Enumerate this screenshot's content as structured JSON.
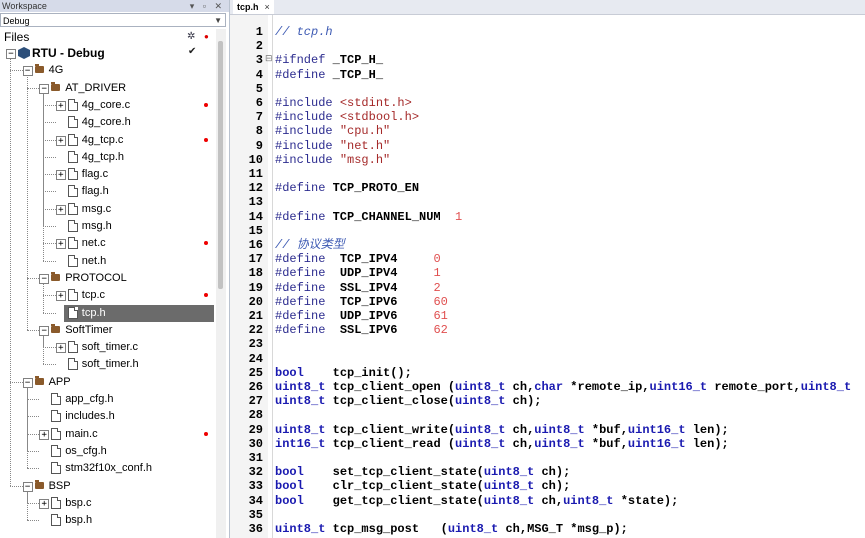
{
  "workspace": {
    "title": "Workspace",
    "config": "Debug",
    "files_label": "Files",
    "tree": [
      {
        "label": "RTU - Debug",
        "level": 0,
        "type": "project",
        "toggle": "-",
        "check": true
      },
      {
        "label": "4G",
        "level": 1,
        "type": "folder",
        "toggle": "-"
      },
      {
        "label": "AT_DRIVER",
        "level": 2,
        "type": "folder",
        "toggle": "-"
      },
      {
        "label": "4g_core.c",
        "level": 3,
        "type": "file",
        "toggle": "+",
        "dot": true
      },
      {
        "label": "4g_core.h",
        "level": 3,
        "type": "file"
      },
      {
        "label": "4g_tcp.c",
        "level": 3,
        "type": "file",
        "toggle": "+",
        "dot": true
      },
      {
        "label": "4g_tcp.h",
        "level": 3,
        "type": "file"
      },
      {
        "label": "flag.c",
        "level": 3,
        "type": "file",
        "toggle": "+"
      },
      {
        "label": "flag.h",
        "level": 3,
        "type": "file"
      },
      {
        "label": "msg.c",
        "level": 3,
        "type": "file",
        "toggle": "+"
      },
      {
        "label": "msg.h",
        "level": 3,
        "type": "file"
      },
      {
        "label": "net.c",
        "level": 3,
        "type": "file",
        "toggle": "+",
        "dot": true
      },
      {
        "label": "net.h",
        "level": 3,
        "type": "file"
      },
      {
        "label": "PROTOCOL",
        "level": 2,
        "type": "folder",
        "toggle": "-"
      },
      {
        "label": "tcp.c",
        "level": 3,
        "type": "file",
        "toggle": "+",
        "dot": true
      },
      {
        "label": "tcp.h",
        "level": 3,
        "type": "file",
        "selected": true
      },
      {
        "label": "SoftTimer",
        "level": 2,
        "type": "folder",
        "toggle": "-"
      },
      {
        "label": "soft_timer.c",
        "level": 3,
        "type": "file",
        "toggle": "+"
      },
      {
        "label": "soft_timer.h",
        "level": 3,
        "type": "file"
      },
      {
        "label": "APP",
        "level": 1,
        "type": "folder",
        "toggle": "-"
      },
      {
        "label": "app_cfg.h",
        "level": 2,
        "type": "file"
      },
      {
        "label": "includes.h",
        "level": 2,
        "type": "file"
      },
      {
        "label": "main.c",
        "level": 2,
        "type": "file",
        "toggle": "+",
        "dot": true
      },
      {
        "label": "os_cfg.h",
        "level": 2,
        "type": "file"
      },
      {
        "label": "stm32f10x_conf.h",
        "level": 2,
        "type": "file"
      },
      {
        "label": "BSP",
        "level": 1,
        "type": "folder",
        "toggle": "-"
      },
      {
        "label": "bsp.c",
        "level": 2,
        "type": "file",
        "toggle": "+"
      },
      {
        "label": "bsp.h",
        "level": 2,
        "type": "file"
      }
    ]
  },
  "editor": {
    "tab_label": "tcp.h",
    "tab_close": "×",
    "lines": [
      {
        "n": "1",
        "spans": [
          [
            "c",
            "// tcp.h"
          ]
        ]
      },
      {
        "n": "2",
        "spans": []
      },
      {
        "n": "3",
        "fold": true,
        "spans": [
          [
            "p",
            "#ifndef "
          ],
          [
            "b",
            "_TCP_H_"
          ]
        ]
      },
      {
        "n": "4",
        "spans": [
          [
            "p",
            "#define "
          ],
          [
            "b",
            "_TCP_H_"
          ]
        ]
      },
      {
        "n": "5",
        "spans": []
      },
      {
        "n": "6",
        "spans": [
          [
            "p",
            "#include "
          ],
          [
            "s",
            "<stdint.h>"
          ]
        ]
      },
      {
        "n": "7",
        "spans": [
          [
            "p",
            "#include "
          ],
          [
            "s",
            "<stdbool.h>"
          ]
        ]
      },
      {
        "n": "8",
        "spans": [
          [
            "p",
            "#include "
          ],
          [
            "s",
            "\"cpu.h\""
          ]
        ]
      },
      {
        "n": "9",
        "spans": [
          [
            "p",
            "#include "
          ],
          [
            "s",
            "\"net.h\""
          ]
        ]
      },
      {
        "n": "10",
        "spans": [
          [
            "p",
            "#include "
          ],
          [
            "s",
            "\"msg.h\""
          ]
        ]
      },
      {
        "n": "11",
        "spans": []
      },
      {
        "n": "12",
        "spans": [
          [
            "p",
            "#define "
          ],
          [
            "b",
            "TCP_PROTO_EN"
          ]
        ]
      },
      {
        "n": "13",
        "spans": []
      },
      {
        "n": "14",
        "spans": [
          [
            "p",
            "#define "
          ],
          [
            "b",
            "TCP_CHANNEL_NUM  "
          ],
          [
            "n",
            "1"
          ]
        ]
      },
      {
        "n": "15",
        "spans": []
      },
      {
        "n": "16",
        "spans": [
          [
            "c",
            "// 协议类型"
          ]
        ]
      },
      {
        "n": "17",
        "spans": [
          [
            "p",
            "#define  "
          ],
          [
            "b",
            "TCP_IPV4     "
          ],
          [
            "n",
            "0"
          ]
        ]
      },
      {
        "n": "18",
        "spans": [
          [
            "p",
            "#define  "
          ],
          [
            "b",
            "UDP_IPV4     "
          ],
          [
            "n",
            "1"
          ]
        ]
      },
      {
        "n": "19",
        "spans": [
          [
            "p",
            "#define  "
          ],
          [
            "b",
            "SSL_IPV4     "
          ],
          [
            "n",
            "2"
          ]
        ]
      },
      {
        "n": "20",
        "spans": [
          [
            "p",
            "#define  "
          ],
          [
            "b",
            "TCP_IPV6     "
          ],
          [
            "n",
            "60"
          ]
        ]
      },
      {
        "n": "21",
        "spans": [
          [
            "p",
            "#define  "
          ],
          [
            "b",
            "UDP_IPV6     "
          ],
          [
            "n",
            "61"
          ]
        ]
      },
      {
        "n": "22",
        "spans": [
          [
            "p",
            "#define  "
          ],
          [
            "b",
            "SSL_IPV6     "
          ],
          [
            "n",
            "62"
          ]
        ]
      },
      {
        "n": "23",
        "spans": []
      },
      {
        "n": "24",
        "spans": []
      },
      {
        "n": "25",
        "spans": [
          [
            "k",
            "bool"
          ],
          [
            "b",
            "    tcp_init();"
          ]
        ]
      },
      {
        "n": "26",
        "spans": [
          [
            "k",
            "uint8_t"
          ],
          [
            "b",
            " tcp_client_open ("
          ],
          [
            "k",
            "uint8_t"
          ],
          [
            "b",
            " ch,"
          ],
          [
            "k",
            "char"
          ],
          [
            "b",
            " *remote_ip,"
          ],
          [
            "k",
            "uint16_t"
          ],
          [
            "b",
            " remote_port,"
          ],
          [
            "k",
            "uint8_t"
          ]
        ]
      },
      {
        "n": "27",
        "spans": [
          [
            "k",
            "uint8_t"
          ],
          [
            "b",
            " tcp_client_close("
          ],
          [
            "k",
            "uint8_t"
          ],
          [
            "b",
            " ch);"
          ]
        ]
      },
      {
        "n": "28",
        "spans": []
      },
      {
        "n": "29",
        "spans": [
          [
            "k",
            "uint8_t"
          ],
          [
            "b",
            " tcp_client_write("
          ],
          [
            "k",
            "uint8_t"
          ],
          [
            "b",
            " ch,"
          ],
          [
            "k",
            "uint8_t"
          ],
          [
            "b",
            " *buf,"
          ],
          [
            "k",
            "uint16_t"
          ],
          [
            "b",
            " len);"
          ]
        ]
      },
      {
        "n": "30",
        "spans": [
          [
            "k",
            "int16_t"
          ],
          [
            "b",
            " tcp_client_read ("
          ],
          [
            "k",
            "uint8_t"
          ],
          [
            "b",
            " ch,"
          ],
          [
            "k",
            "uint8_t"
          ],
          [
            "b",
            " *buf,"
          ],
          [
            "k",
            "uint16_t"
          ],
          [
            "b",
            " len);"
          ]
        ]
      },
      {
        "n": "31",
        "spans": []
      },
      {
        "n": "32",
        "spans": [
          [
            "k",
            "bool"
          ],
          [
            "b",
            "    set_tcp_client_state("
          ],
          [
            "k",
            "uint8_t"
          ],
          [
            "b",
            " ch);"
          ]
        ]
      },
      {
        "n": "33",
        "spans": [
          [
            "k",
            "bool"
          ],
          [
            "b",
            "    clr_tcp_client_state("
          ],
          [
            "k",
            "uint8_t"
          ],
          [
            "b",
            " ch);"
          ]
        ]
      },
      {
        "n": "34",
        "spans": [
          [
            "k",
            "bool"
          ],
          [
            "b",
            "    get_tcp_client_state("
          ],
          [
            "k",
            "uint8_t"
          ],
          [
            "b",
            " ch,"
          ],
          [
            "k",
            "uint8_t"
          ],
          [
            "b",
            " *state);"
          ]
        ]
      },
      {
        "n": "35",
        "spans": []
      },
      {
        "n": "36",
        "spans": [
          [
            "k",
            "uint8_t"
          ],
          [
            "b",
            " tcp_msg_post   ("
          ],
          [
            "k",
            "uint8_t"
          ],
          [
            "b",
            " ch,MSG_T *msg_p);"
          ]
        ]
      }
    ]
  },
  "colors": {
    "selection": "#6b6b6b",
    "comment": "#3d5ab3",
    "keyword": "#1a1ab0",
    "string": "#a52a2a",
    "number": "#e05050"
  }
}
